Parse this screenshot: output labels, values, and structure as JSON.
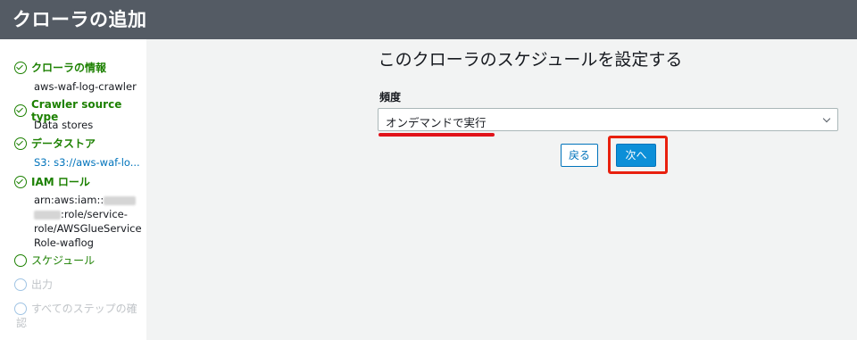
{
  "header": {
    "title": "クローラの追加"
  },
  "sidebar": {
    "steps": [
      {
        "label": "クローラの情報",
        "detail": "aws-waf-log-crawler",
        "state": "done"
      },
      {
        "label": "Crawler source type",
        "detail": "Data stores",
        "state": "done"
      },
      {
        "label": "データストア",
        "detail": "S3: s3://aws-waf-lo...",
        "state": "done"
      },
      {
        "label": "IAM ロール",
        "detail_prefix": "arn:aws:iam::",
        "detail_line2": ":role/service-",
        "detail_line3": "role/AWSGlueService",
        "detail_line4": "Role-waflog",
        "state": "done"
      },
      {
        "label": "スケジュール",
        "state": "current"
      },
      {
        "label": "出力",
        "state": "pending"
      },
      {
        "label": "すべてのステップの確",
        "label_line2": "認",
        "state": "pending"
      }
    ]
  },
  "main": {
    "title": "このクローラのスケジュールを設定する",
    "frequency_label": "頻度",
    "frequency_value": "オンデマンドで実行",
    "back_label": "戻る",
    "next_label": "次へ"
  },
  "colors": {
    "header_bg": "#545b64",
    "done_green": "#1d8102",
    "link_blue": "#0073bb",
    "primary_button": "#0c8fd8",
    "highlight_red": "#e8200e"
  }
}
